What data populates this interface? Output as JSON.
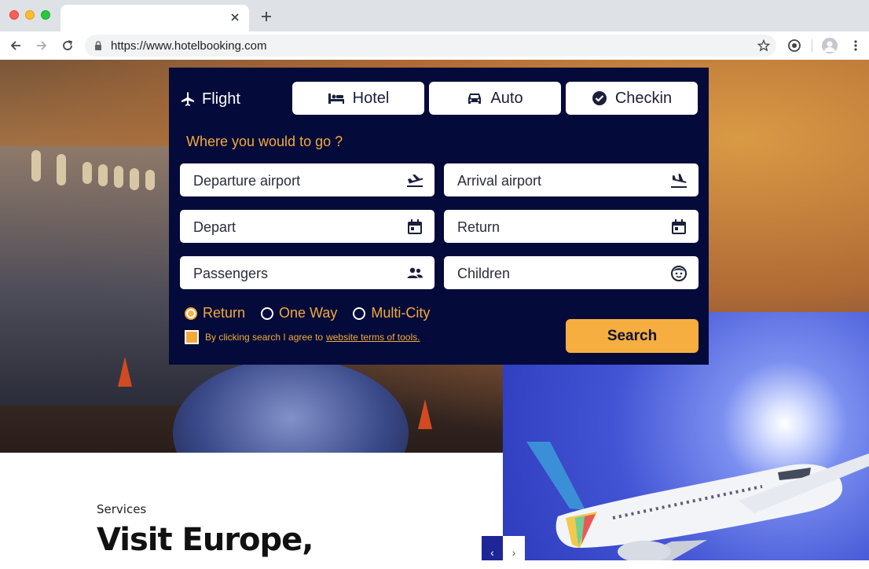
{
  "browser": {
    "url": "https://www.hotelbooking.com"
  },
  "booking": {
    "tabs": [
      {
        "label": "Flight",
        "icon": "airplane-icon"
      },
      {
        "label": "Hotel",
        "icon": "bed-icon"
      },
      {
        "label": "Auto",
        "icon": "car-icon"
      },
      {
        "label": "Checkin",
        "icon": "check-circle-icon"
      }
    ],
    "prompt": "Where you would to go ?",
    "fields": {
      "departure": "Departure airport",
      "arrival": "Arrival airport",
      "depart": "Depart",
      "return": "Return",
      "passengers": "Passengers",
      "children": "Children"
    },
    "trip_types": [
      {
        "label": "Return",
        "selected": true
      },
      {
        "label": "One Way",
        "selected": false
      },
      {
        "label": "Multi-City",
        "selected": false
      }
    ],
    "terms_text": "By clicking search I agree to",
    "terms_link": "website terms of tools.",
    "search_label": "Search",
    "colors": {
      "accent": "#f5ae3f",
      "panel": "#040b3a"
    }
  },
  "section": {
    "label": "Services",
    "heading": "Visit Europe,"
  }
}
